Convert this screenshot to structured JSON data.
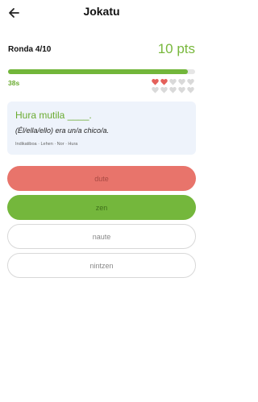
{
  "header": {
    "title": "Jokatu",
    "back_icon": "arrow-left-icon"
  },
  "status": {
    "round": "Ronda 4/10",
    "points": "10 pts",
    "time": "38s",
    "progress_fraction": 0.96
  },
  "lives": {
    "total": 10,
    "full": 2,
    "full_color": "#e4605a",
    "empty_color": "#d9d9d9"
  },
  "question": {
    "prompt": "Hura mutila ____.",
    "translation": "(Él/ella/ello) era un/a chico/a.",
    "meta": "Indikatiboa · Lehen · Nor · Hura"
  },
  "options": [
    {
      "label": "dute",
      "state": "wrong"
    },
    {
      "label": "zen",
      "state": "correct"
    },
    {
      "label": "naute",
      "state": "neutral"
    },
    {
      "label": "nintzen",
      "state": "neutral"
    }
  ],
  "colors": {
    "accent": "#72b63a",
    "wrong": "#e8746b",
    "card_bg": "#eef3fb"
  }
}
